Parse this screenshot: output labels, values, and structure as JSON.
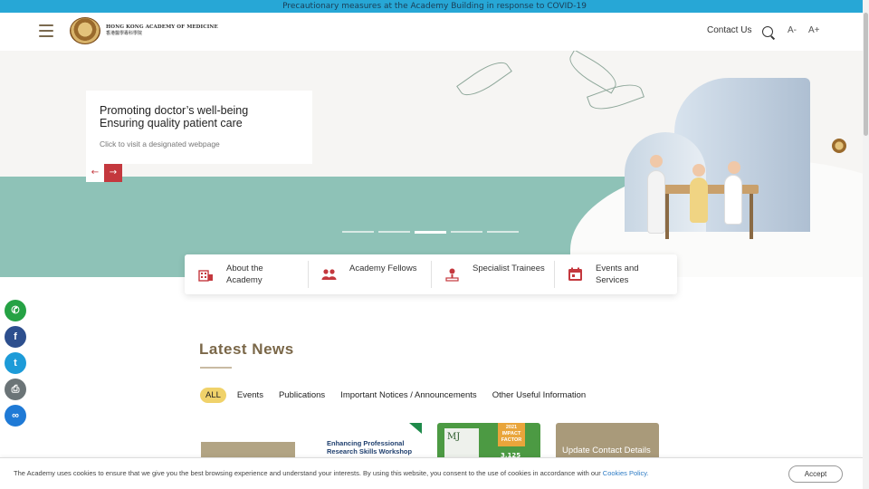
{
  "notice_bar": {
    "text": "Precautionary measures at the Academy Building in response to COVID-19"
  },
  "header": {
    "logo_en": "HONG KONG ACADEMY OF MEDICINE",
    "logo_zh": "香港醫學專科學院",
    "contact_label": "Contact Us",
    "font_decrease": "A-",
    "font_increase": "A+"
  },
  "hero": {
    "caption_line1": "Promoting doctor’s well-being",
    "caption_line2": "Ensuring quality patient care",
    "caption_sub": "Click to visit a designated webpage",
    "prev_arrow": "←",
    "next_arrow": "→",
    "slide_count": 5,
    "active_slide": 3
  },
  "quick_links": [
    {
      "label": "About the Academy",
      "icon": "academy-building-icon"
    },
    {
      "label": "Academy Fellows",
      "icon": "people-group-icon"
    },
    {
      "label": "Specialist Trainees",
      "icon": "trainee-icon"
    },
    {
      "label": "Events and Services",
      "icon": "calendar-icon"
    }
  ],
  "social": [
    {
      "name": "whatsapp",
      "glyph": "✆",
      "color": "#25a244"
    },
    {
      "name": "facebook",
      "glyph": "f",
      "color": "#2d4f8e"
    },
    {
      "name": "twitter",
      "glyph": "t",
      "color": "#1d9bd8"
    },
    {
      "name": "print",
      "glyph": "⎙",
      "color": "#6b7477"
    },
    {
      "name": "copy-link",
      "glyph": "∞",
      "color": "#1f7ad6"
    }
  ],
  "news": {
    "title": "Latest News",
    "tabs": [
      {
        "label": "ALL",
        "active": true
      },
      {
        "label": "Events",
        "active": false
      },
      {
        "label": "Publications",
        "active": false
      },
      {
        "label": "Important Notices / Announcements",
        "active": false
      },
      {
        "label": "Other Useful Information",
        "active": false
      }
    ],
    "card2_line1": "Enhancing Professional",
    "card2_line2": "Research Skills Workshop",
    "card3_journal": "MJ",
    "card3_badge": "2021 IMPACT FACTOR",
    "card3_number": "3.125",
    "card4_title": "Update Contact Details"
  },
  "cookie": {
    "text": "The Academy uses cookies to ensure that we give you the best browsing experience and understand your interests. By using this website, you consent to the use of cookies in accordance with our",
    "link": "Cookies Policy.",
    "accept": "Accept"
  },
  "colors": {
    "accent": "#c4383e",
    "notice": "#27a7d6",
    "heading": "#7a6748",
    "tab_active": "#f0d26a"
  }
}
